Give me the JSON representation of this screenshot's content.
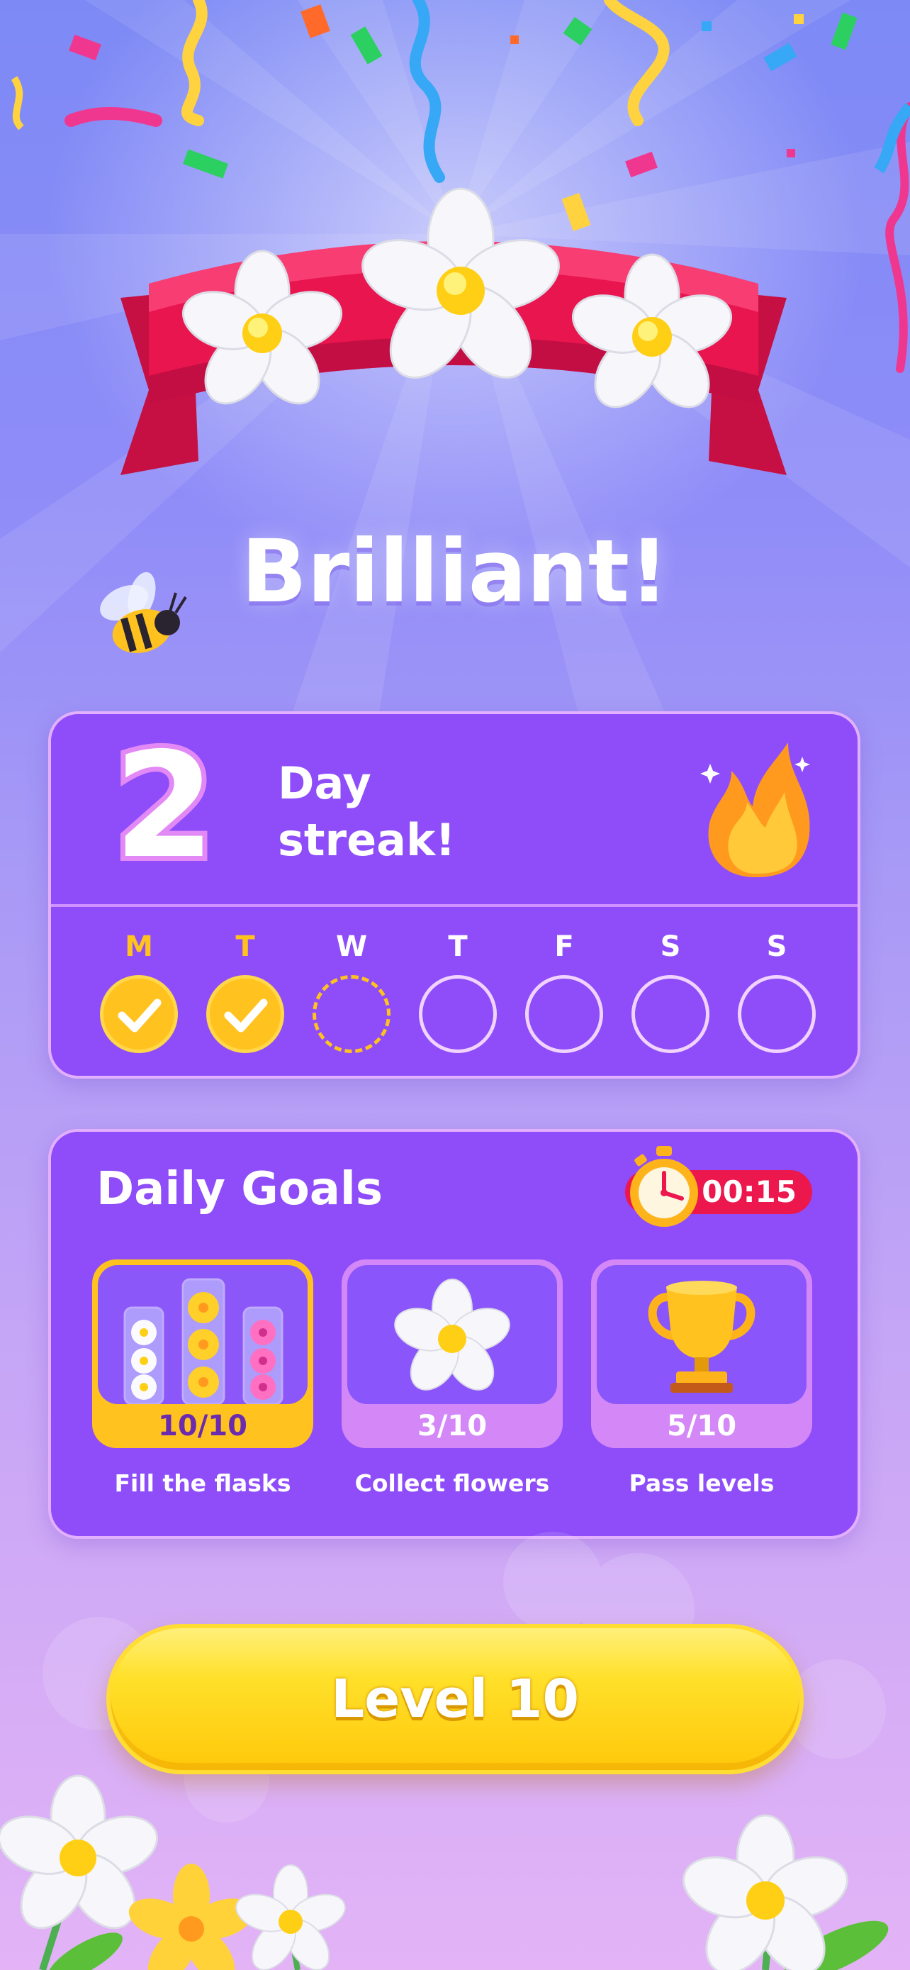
{
  "result": {
    "title": "Brilliant!"
  },
  "streak": {
    "count": "2",
    "line1": "Day",
    "line2": "streak!",
    "days": [
      {
        "letter": "M",
        "state": "done"
      },
      {
        "letter": "T",
        "state": "done"
      },
      {
        "letter": "W",
        "state": "today"
      },
      {
        "letter": "T",
        "state": "empty"
      },
      {
        "letter": "F",
        "state": "empty"
      },
      {
        "letter": "S",
        "state": "empty"
      },
      {
        "letter": "S",
        "state": "empty"
      }
    ]
  },
  "goals": {
    "title": "Daily Goals",
    "timer": "00:15",
    "items": [
      {
        "progress": "10/10",
        "label": "Fill the flasks",
        "complete": true,
        "icon": "flasks-icon"
      },
      {
        "progress": "3/10",
        "label": "Collect flowers",
        "complete": false,
        "icon": "flower-icon"
      },
      {
        "progress": "5/10",
        "label": "Pass levels",
        "complete": false,
        "icon": "trophy-icon"
      }
    ]
  },
  "play": {
    "label": "Level 10"
  },
  "colors": {
    "accent": "#ffc21e",
    "card": "#8e4df9",
    "timer": "#ec174c",
    "ribbon": "#e8154f"
  }
}
